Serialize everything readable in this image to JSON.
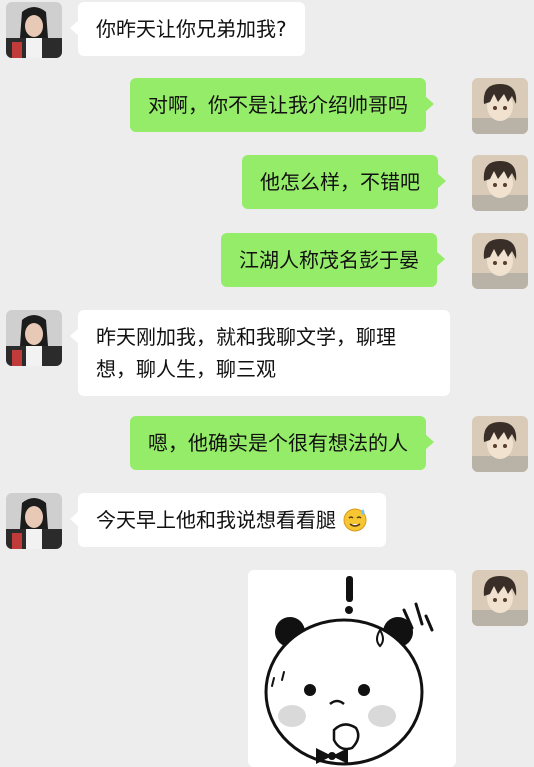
{
  "messages": [
    {
      "side": "left",
      "text": "你昨天让你兄弟加我?"
    },
    {
      "side": "right",
      "text": "对啊，你不是让我介绍帅哥吗"
    },
    {
      "side": "right",
      "text": "他怎么样，不错吧"
    },
    {
      "side": "right",
      "text": "江湖人称茂名彭于晏"
    },
    {
      "side": "left",
      "text": "昨天刚加我，就和我聊文学，聊理想，聊人生，聊三观"
    },
    {
      "side": "right",
      "text": "嗯，他确实是个很有想法的人"
    },
    {
      "side": "left",
      "text": "今天早上他和我说想看看腿",
      "emoji": "nervous-sweat-face-emoji"
    },
    {
      "side": "right",
      "sticker": "shocked-bear-sticker"
    }
  ],
  "colors": {
    "background": "#ededed",
    "bubble_left": "#ffffff",
    "bubble_right": "#95ec69"
  }
}
